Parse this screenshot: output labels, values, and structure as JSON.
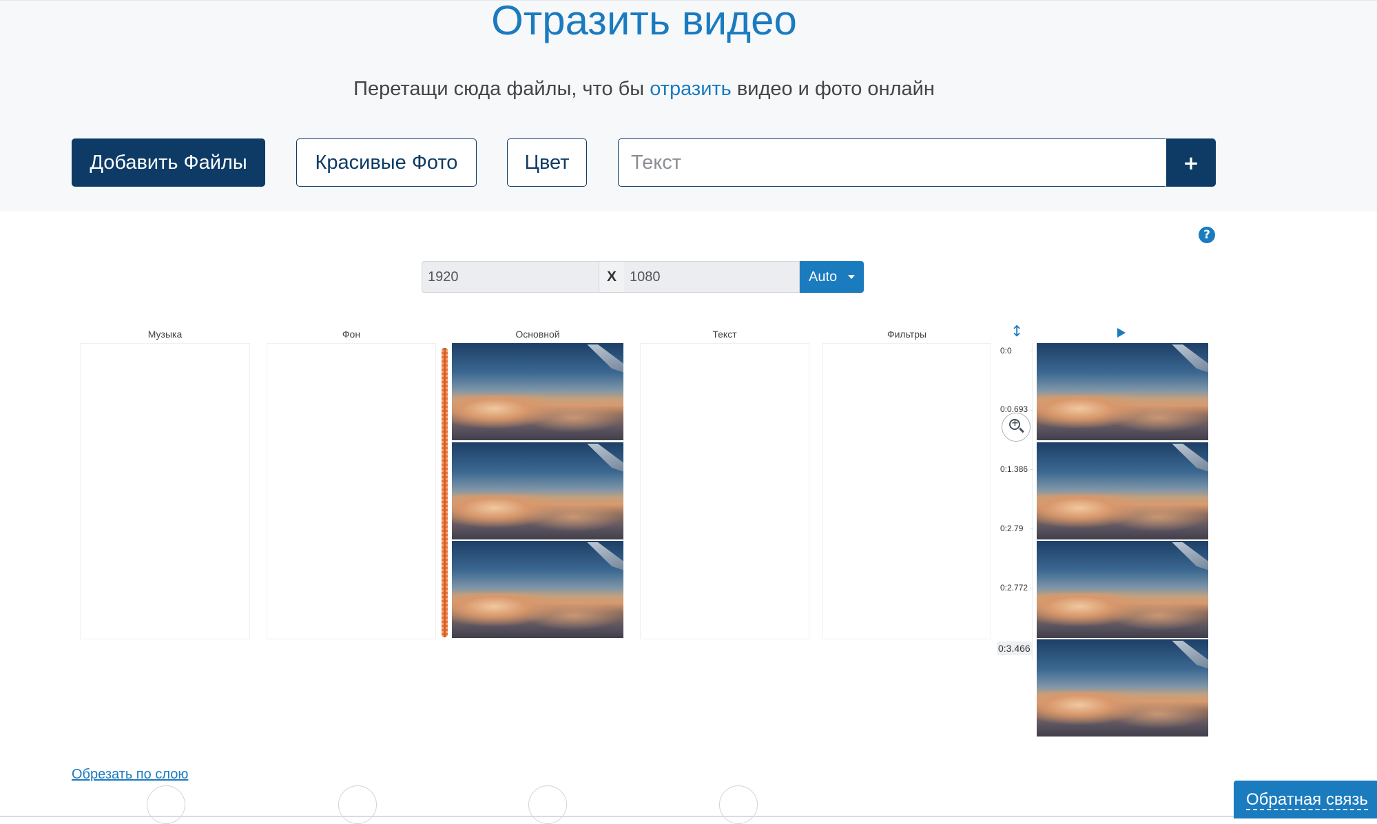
{
  "header": {
    "title": "Отразить видео",
    "subtitle_before": "Перетащи сюда файлы, что бы",
    "subtitle_link": "отразить",
    "subtitle_after": "видео и фото онлайн"
  },
  "toolbar": {
    "add_files": "Добавить Файлы",
    "beautiful_photos": "Красивые Фото",
    "color": "Цвет",
    "text_placeholder": "Текст",
    "add_text": "+"
  },
  "help": {
    "label": "?"
  },
  "dimensions": {
    "width": "1920",
    "separator": "X",
    "height": "1080",
    "mode": "Auto"
  },
  "columns": {
    "music": "Музыка",
    "background": "Фон",
    "main": "Основной",
    "text": "Текст",
    "filters": "Фильтры"
  },
  "timeline": {
    "ticks": [
      "0:0",
      "0:0.693",
      "0:1.386",
      "0:2.79",
      "0:2.772"
    ],
    "current_time": "0:3.466"
  },
  "footer": {
    "crop_link": "Обрезать по слою",
    "feedback": "Обратная связь"
  },
  "colors": {
    "primary": "#0d3b66",
    "accent": "#1a7bbf",
    "waveform": "#e8733a"
  },
  "icons": [
    "help-icon",
    "resize-icon",
    "play-icon",
    "zoom-in-icon"
  ]
}
